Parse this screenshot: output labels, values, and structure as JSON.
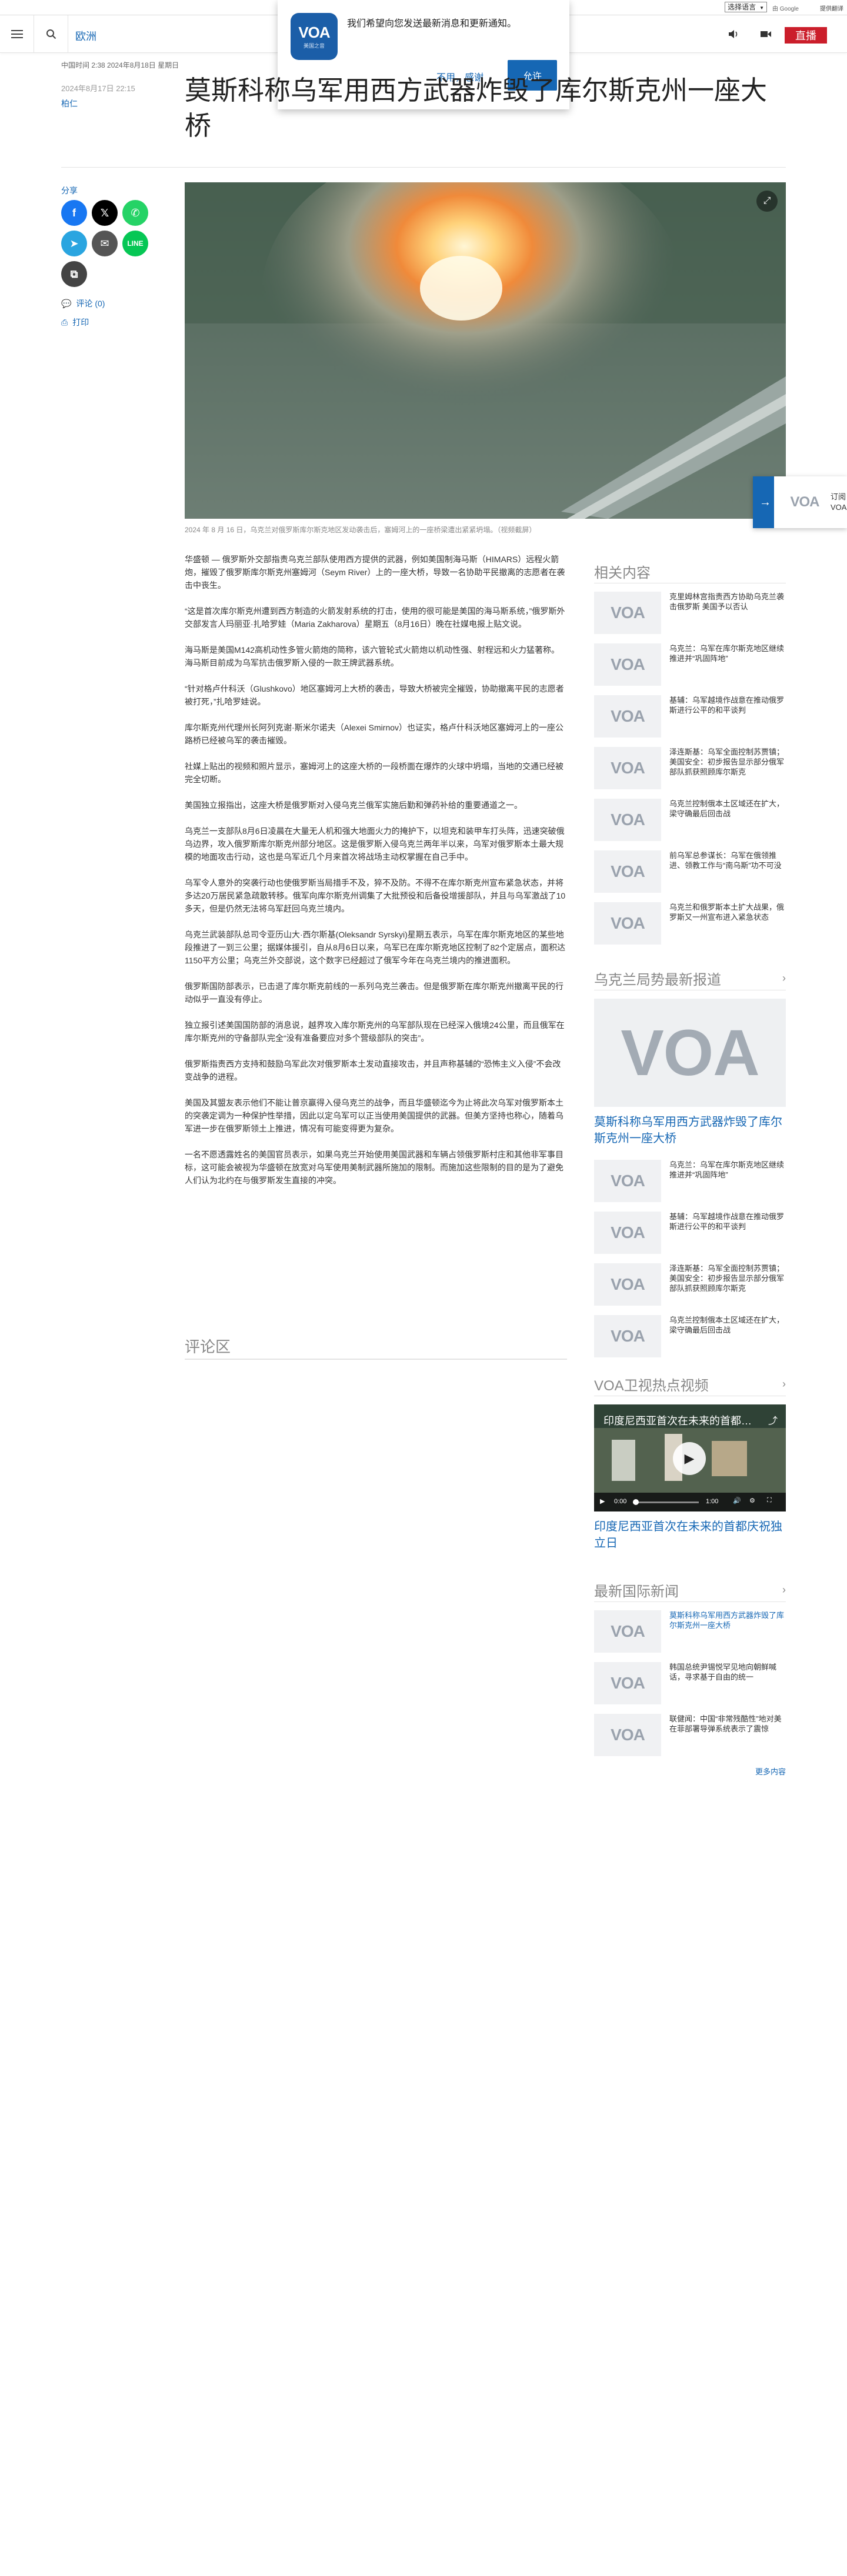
{
  "utility": {
    "language_select": "选择语言",
    "google_powered": "由 Google",
    "google_translate": "提供翻译"
  },
  "header": {
    "section": "欧洲",
    "live": "直播"
  },
  "notification": {
    "message": "我们希望向您发送最新消息和更新通知。",
    "decline": "不用，感谢",
    "accept": "允许",
    "logo_text": "VOA",
    "logo_sub": "美国之音"
  },
  "article": {
    "dateline": "中国时间 2:38 2024年8月18日 星期日",
    "date": "2024年8月17日 22:15",
    "author": "柏仁",
    "headline": "莫斯科称乌军用西方武器炸毁了库尔斯克州一座大桥",
    "caption": "2024 年 8 月 16 日，乌克兰对俄罗斯库尔斯克地区发动袭击后，塞姆河上的一座桥梁遭出紧紧坍塌。（视频截屏）",
    "paragraphs": [
      "华盛顿 — 俄罗斯外交部指责乌克兰部队使用西方提供的武器，例如美国制海马斯（HIMARS）远程火箭炮，摧毁了俄罗斯库尔斯克州塞姆河（Seym River）上的一座大桥，导致一名协助平民撤离的志愿者在袭击中丧生。",
      "“这是首次库尔斯克州遭到西方制造的火箭发射系统的打击，使用的很可能是美国的海马斯系统，”俄罗斯外交部发言人玛丽亚·扎哈罗娃（Maria Zakharova）星期五（8月16日）晚在社媒电报上贴文说。",
      "海马斯是美国M142高机动性多管火箭炮的简称，该六管轮式火箭炮以机动性强、射程远和火力猛著称。海马斯目前成为乌军抗击俄罗斯入侵的一款王牌武器系统。",
      "“针对格卢什科沃（Glushkovo）地区塞姆河上大桥的袭击，导致大桥被完全摧毁，协助撤离平民的志愿者被打死，”扎哈罗娃说。",
      "库尔斯克州代理州长阿列克谢·斯米尔诺夫（Alexei Smirnov）也证实，格卢什科沃地区塞姆河上的一座公路桥已经被乌军的袭击摧毁。",
      "社媒上贴出的视频和照片显示，塞姆河上的这座大桥的一段桥面在爆炸的火球中坍塌，当地的交通已经被完全切断。",
      "美国独立报指出，这座大桥是俄罗斯对入侵乌克兰俄军实施后勤和弹药补给的重要通道之一。",
      "乌克兰一支部队8月6日凌晨在大量无人机和强大地面火力的掩护下，以坦克和装甲车打头阵，迅速突破俄乌边界，攻入俄罗斯库尔斯克州部分地区。这是俄罗斯入侵乌克兰两年半以来，乌军对俄罗斯本土最大规模的地面攻击行动，这也是乌军近几个月来首次将战场主动权掌握在自己手中。",
      "乌军令人意外的突袭行动也使俄罗斯当局措手不及，猝不及防。不得不在库尔斯克州宣布紧急状态，并将多达20万居民紧急疏散转移。俄军向库尔斯克州调集了大批预役和后备役增援部队，并且与乌军激战了10多天，但是仍然无法将乌军赶回乌克兰境内。",
      "乌克兰武装部队总司令亚历山大·西尔斯基(Oleksandr Syrskyi)星期五表示，乌军在库尔斯克地区的某些地段推进了一到三公里；据媒体援引，自从8月6日以来，乌军已在库尔斯克地区控制了82个定居点，面积达1150平方公里；乌克兰外交部说，这个数字已经超过了俄军今年在乌克兰境内的推进面积。",
      "俄罗斯国防部表示，已击退了库尔斯克前线的一系列乌克兰袭击。但是俄罗斯在库尔斯克州撤离平民的行动似乎一直没有停止。",
      "独立报引述美国国防部的消息说，越界攻入库尔斯克州的乌军部队现在已经深入俄境24公里，而且俄军在库尔斯克州的守备部队完全“没有准备要应对多个营级部队的突击”。",
      "俄罗斯指责西方支持和鼓励乌军此次对俄罗斯本土发动直接攻击，并且声称基辅的“恐怖主义入侵”不会改变战争的进程。",
      "美国及其盟友表示他们不能让普京赢得入侵乌克兰的战争，而且华盛顿迄今为止将此次乌军对俄罗斯本土的突袭定调为一种保护性举措，因此以定乌军可以正当使用美国提供的武器。但美方坚持也称心，随着乌军进一步在俄罗斯领土上推进，情况有可能变得更为复杂。",
      "一名不愿透露姓名的美国官员表示，如果乌克兰开始使用美国武器和车辆占领俄罗斯村庄和其他非军事目标，这可能会被视为华盛顿在放宽对乌军使用美制武器所施加的限制。而施加这些限制的目的是为了避免人们认为北约在与俄罗斯发生直接的冲突。"
    ],
    "comments_title": "评论区"
  },
  "share": {
    "label": "分享",
    "comments": "评论 (0)",
    "print": "打印"
  },
  "sidebar": {
    "related_title": "相关内容",
    "related": [
      "克里姆林宫指责西方协助乌克兰袭击俄罗斯 美国予以否认",
      "乌克兰：乌军在库尔斯克地区继续推进并“巩固阵地”",
      "基辅：乌军越境作战意在推动俄罗斯进行公平的和平谈判",
      "泽连斯基：乌军全面控制苏贾镇；美国安全：初步报告显示部分俄军部队抓获照顾库尔斯克",
      "乌克兰控制俄本土区域还在扩大，梁守确最后回击战",
      "前乌军总参谋长：乌军在俄领推进、领教工作与“南乌斯”功不可没",
      "乌克兰和俄罗斯本土扩大战果，俄罗斯又一州宣布进入紧急状态"
    ],
    "ukraine_title": "乌克兰局势最新报道",
    "feature_title": "莫斯科称乌军用西方武器炸毁了库尔斯克州一座大桥",
    "ukraine": [
      "乌克兰：乌军在库尔斯克地区继续推进并“巩固阵地”",
      "基辅：乌军越境作战意在推动俄罗斯进行公平的和平谈判",
      "泽连斯基：乌军全面控制苏贾镇；美国安全：初步报告显示部分俄军部队抓获照顾库尔斯克",
      "乌克兰控制俄本土区域还在扩大，梁守确最后回击战"
    ],
    "video_title": "VOA卫视热点视频",
    "video_overlay": "印度尼西亚首次在未来的首都庆祝独立日",
    "video_time_start": "0:00",
    "video_time_end": "1:00",
    "video_caption": "印度尼西亚首次在未来的首都庆祝独立日",
    "intl_title": "最新国际新闻",
    "intl": [
      "莫斯科称乌军用西方武器炸毁了库尔斯克州一座大桥",
      "韩国总统尹锡悦罕见地向朝鲜喊话，寻求基于自由的统一",
      "联健闻：中国“非常残酷性”地对美在菲部署导弹系统表示了震惊"
    ],
    "more": "更多内容"
  },
  "side_tab": {
    "text": "订阅 VOA"
  },
  "colors": {
    "brand_blue": "#1667b4",
    "live_red": "#cb1e2b"
  }
}
